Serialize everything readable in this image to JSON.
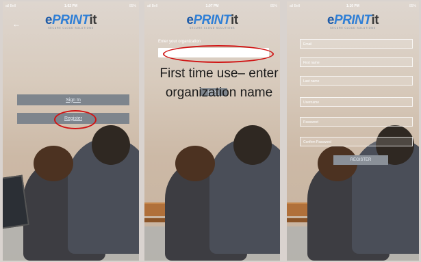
{
  "logo": {
    "e": "e",
    "print": "PRINT",
    "it": "it",
    "tagline": "SECURE CLOUD SOLUTIONS"
  },
  "screens": [
    {
      "status": {
        "carrier": "atl Bell",
        "time": "1:02 PM",
        "battery": "85%"
      },
      "buttons": {
        "sign_in": "Sign In",
        "register": "Register"
      }
    },
    {
      "status": {
        "carrier": "atl Bell",
        "time": "1:07 PM",
        "battery": "85%"
      },
      "org_label": "Enter your organization",
      "next": "NEXT"
    },
    {
      "status": {
        "carrier": "atl Bell",
        "time": "1:10 PM",
        "battery": "85%"
      },
      "fields": [
        "Email",
        "First name",
        "Last name",
        "Username",
        "Password",
        "Confirm Password"
      ],
      "register": "REGISTER"
    }
  ],
  "caption": {
    "line1": "First time use– enter",
    "line2": "organization name"
  },
  "colors": {
    "annotation": "#d01414",
    "button": "#7e858d"
  },
  "icons": {
    "back": "back-arrow-icon"
  }
}
